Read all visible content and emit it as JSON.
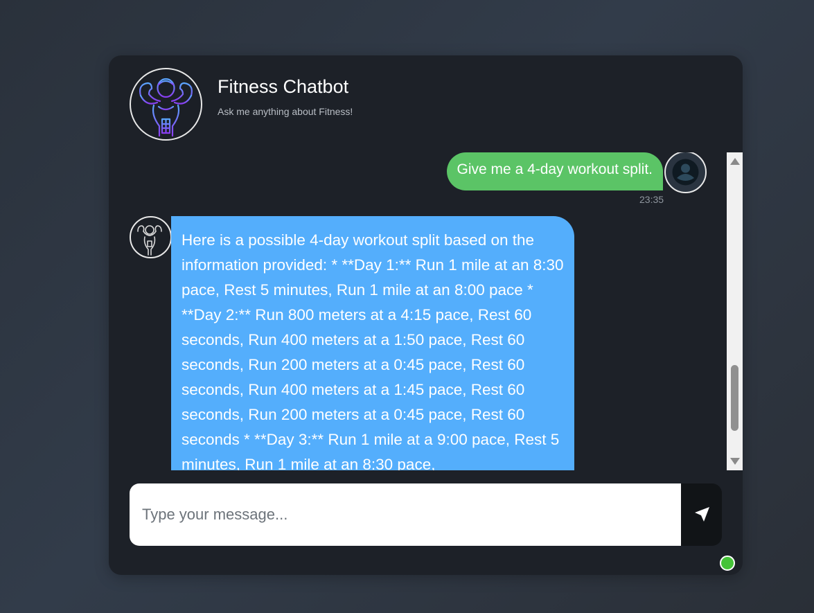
{
  "header": {
    "title": "Fitness Chatbot",
    "subtitle": "Ask me anything about Fitness!",
    "logo_icon": "muscular-man-icon"
  },
  "messages": [
    {
      "sender": "user",
      "text": "Give me a 4-day workout split.",
      "time": "23:35",
      "bubble_color": "#5bc466",
      "avatar_icon": "user-icon"
    },
    {
      "sender": "bot",
      "text": "Here is a possible 4-day workout split based on the information provided: * **Day 1:** Run 1 mile at an 8:30 pace, Rest 5 minutes, Run 1 mile at an 8:00 pace * **Day 2:** Run 800 meters at a 4:15 pace, Rest 60 seconds, Run 400 meters at a 1:50 pace, Rest 60 seconds, Run 200 meters at a 0:45 pace, Rest 60 seconds, Run 400 meters at a 1:45 pace, Rest 60 seconds, Run 200 meters at a 0:45 pace, Rest 60 seconds * **Day 3:** Run 1 mile at a 9:00 pace, Rest 5 minutes, Run 1 mile at an 8:30 pace,",
      "bubble_color": "#54aefc",
      "avatar_icon": "flexing-man-icon"
    }
  ],
  "input": {
    "placeholder": "Type your message...",
    "value": "",
    "send_icon": "send-arrow-icon"
  },
  "status": {
    "color": "#45c338",
    "state": "online"
  }
}
